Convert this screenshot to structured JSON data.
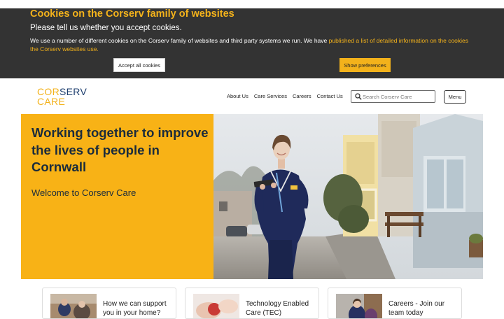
{
  "cookie_banner": {
    "title": "Cookies on the Corserv family of websites",
    "question": "Please tell us whether you accept cookies.",
    "text": "We use a number of different cookies on the Corserv family of websites and third party systems we run. We have ",
    "link_text": "published a list of detailed information on the cookies the Corserv websites use.",
    "accept_label": "Accept all cookies",
    "prefs_label": "Show preferences"
  },
  "header": {
    "logo_cor": "COR",
    "logo_serv": "SERV",
    "logo_care": "CARE",
    "nav": [
      "About Us",
      "Care Services",
      "Careers",
      "Contact Us"
    ],
    "search_placeholder": "Search Corserv Care",
    "menu_label": "Menu"
  },
  "hero": {
    "title": "Working together to improve the lives of people in Cornwall",
    "subtitle": "Welcome to Corserv Care"
  },
  "cards": [
    {
      "label": "How we can support you in your home?"
    },
    {
      "label": "Technology Enabled Care (TEC)"
    },
    {
      "label": "Careers - Join our team today"
    }
  ],
  "colors": {
    "accent": "#f8b216",
    "banner_bg": "#333333",
    "navy": "#1d3e6e"
  }
}
